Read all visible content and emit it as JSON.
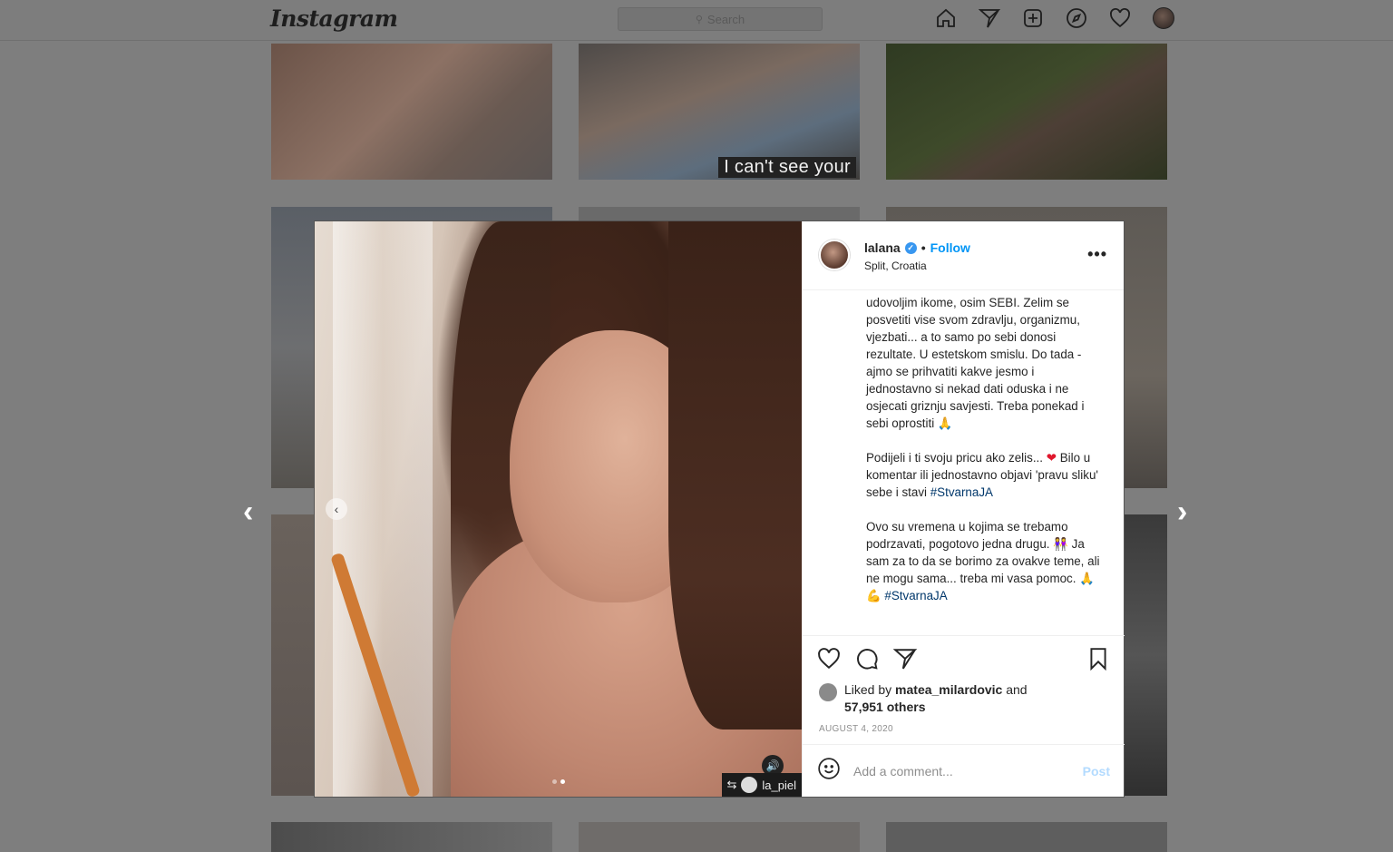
{
  "topbar": {
    "logo": "Instagram",
    "search_placeholder": "Search",
    "icons": [
      "home-icon",
      "direct-icon",
      "new-post-icon",
      "explore-icon",
      "activity-heart-icon",
      "profile-avatar"
    ]
  },
  "grid": {
    "tile_overlay_text": "I can't see your"
  },
  "post": {
    "username": "lalana",
    "follow_label": "Follow",
    "location": "Split, Croatia",
    "more_label": "•••",
    "caption": {
      "p1": "udovoljim ikome, osim SEBI. Zelim se posvetiti vise svom zdravlju, organizmu, vjezbati... a to samo po sebi donosi rezultate. U estetskom smislu. Do tada - ajmo se prihvatiti kakve jesmo i jednostavno si nekad dati oduska i ne osjecati griznju savjesti. Treba ponekad i sebi oprostiti",
      "p1_emoji": "🙏",
      "p2_a": "Podijeli i ti svoju pricu ako zelis...",
      "p2_heart": "❤",
      "p2_b": "Bilo u komentar ili jednostavno objavi 'pravu sliku' sebe i stavi",
      "p2_tag": "#StvarnaJA",
      "p3_a": "Ovo su vremena u kojima se trebamo podrzavati, pogotovo jedna drugu.",
      "p3_emoji": "👭",
      "p3_b": "Ja sam za to da se borimo za ovakve teme, ali ne mogu sama... treba mi vasa pomoc.",
      "p3_emoji2": "🙏💪",
      "p3_tag": "#StvarnaJA"
    },
    "likes": {
      "prefix": "Liked by",
      "user": "matea_milardovic",
      "and": "and",
      "others": "57,951 others"
    },
    "date": "AUGUST 4, 2020",
    "comment_placeholder": "Add a comment...",
    "post_label": "Post",
    "repost_user": "la_piel"
  },
  "colors": {
    "accent": "#0095f6",
    "hashtag": "#00376b",
    "overlay_bg": "#7e7e7e"
  }
}
